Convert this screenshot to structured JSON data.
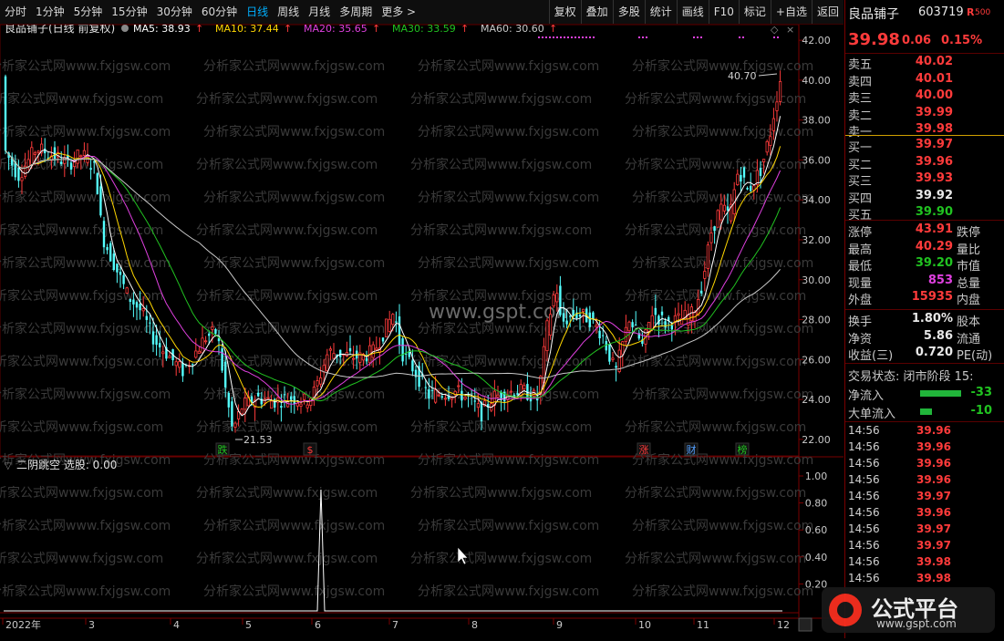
{
  "toolbar": {
    "periods": [
      "分时",
      "1分钟",
      "5分钟",
      "15分钟",
      "30分钟",
      "60分钟",
      "日线",
      "周线",
      "月线",
      "多周期",
      "更多 >"
    ],
    "active": "日线",
    "right_buttons": [
      "复权",
      "叠加",
      "多股",
      "统计",
      "画线",
      "F10",
      "标记",
      "+自选",
      "返回"
    ]
  },
  "chart": {
    "title": "良品铺子(日线 前复权)",
    "ma_labels": [
      {
        "text": "MA5: 38.93",
        "color": "#ffffff"
      },
      {
        "text": "MA10: 37.44",
        "color": "#ffd700"
      },
      {
        "text": "MA20: 35.65",
        "color": "#e040e0"
      },
      {
        "text": "MA30: 33.59",
        "color": "#21c321"
      },
      {
        "text": "MA60: 30.60",
        "color": "#c8c8c8"
      }
    ],
    "watermark_site": "www.gspt.com",
    "watermark_text": "分析家公式网www.fxjgsw.com",
    "high_label": "40.70",
    "low_label": "21.53",
    "markers": [
      "跌",
      "$",
      "涨",
      "财",
      "榜"
    ],
    "y_ticks": [
      "42.00",
      "40.00",
      "38.00",
      "36.00",
      "34.00",
      "32.00",
      "30.00",
      "28.00",
      "26.00",
      "24.00",
      "22.00"
    ],
    "indicator_title": "二阴跳空 选股: 0.00",
    "indicator_ticks": [
      "1.00",
      "0.80",
      "0.60",
      "0.40",
      "0.20"
    ],
    "x_labels": [
      "2022年",
      "3",
      "4",
      "5",
      "6",
      "7",
      "8",
      "9",
      "10",
      "11",
      "12"
    ]
  },
  "sidebar": {
    "name": "良品铺子",
    "code": "603719",
    "flag": "R",
    "flag2": "500",
    "price": "39.98",
    "change": "0.06",
    "change_pct": "0.15%",
    "asks": [
      {
        "label": "卖五",
        "price": "40.02",
        "cls": "red"
      },
      {
        "label": "卖四",
        "price": "40.01",
        "cls": "red"
      },
      {
        "label": "卖三",
        "price": "40.00",
        "cls": "red"
      },
      {
        "label": "卖二",
        "price": "39.99",
        "cls": "red"
      },
      {
        "label": "卖一",
        "price": "39.98",
        "cls": "red"
      }
    ],
    "bids": [
      {
        "label": "买一",
        "price": "39.97",
        "cls": "red"
      },
      {
        "label": "买二",
        "price": "39.96",
        "cls": "red"
      },
      {
        "label": "买三",
        "price": "39.93",
        "cls": "red"
      },
      {
        "label": "买四",
        "price": "39.92",
        "cls": "white"
      },
      {
        "label": "买五",
        "price": "39.90",
        "cls": "green"
      }
    ],
    "stats": [
      {
        "label": "涨停",
        "value": "43.91",
        "cls": "red",
        "right": "跌停"
      },
      {
        "label": "最高",
        "value": "40.29",
        "cls": "red",
        "right": "量比"
      },
      {
        "label": "最低",
        "value": "39.20",
        "cls": "green",
        "right": "市值"
      },
      {
        "label": "现量",
        "value": "853",
        "cls": "mag",
        "right": "总量"
      },
      {
        "label": "外盘",
        "value": "15935",
        "cls": "red",
        "right": "内盘"
      }
    ],
    "stats2": [
      {
        "label": "换手",
        "value": "1.80%",
        "cls": "white",
        "right": "股本"
      },
      {
        "label": "净资",
        "value": "5.86",
        "cls": "white",
        "right": "流通"
      },
      {
        "label": "收益(三)",
        "value": "0.720",
        "cls": "white",
        "right": "PE(动)"
      }
    ],
    "trade_state": "交易状态: 闭市阶段 15:",
    "flows": [
      {
        "label": "净流入",
        "value": "-33",
        "bar": 0.9
      },
      {
        "label": "大单流入",
        "value": "-10",
        "bar": 0.25
      }
    ],
    "ticks": [
      {
        "time": "14:56",
        "price": "39.96"
      },
      {
        "time": "14:56",
        "price": "39.96"
      },
      {
        "time": "14:56",
        "price": "39.96"
      },
      {
        "time": "14:56",
        "price": "39.96"
      },
      {
        "time": "14:56",
        "price": "39.97"
      },
      {
        "time": "14:56",
        "price": "39.96"
      },
      {
        "time": "14:56",
        "price": "39.97"
      },
      {
        "time": "14:56",
        "price": "39.97"
      },
      {
        "time": "14:56",
        "price": "39.98"
      },
      {
        "time": "14:56",
        "price": "39.98"
      }
    ],
    "logo_text": "公式平台",
    "logo_url": "www.gspt.com"
  }
}
